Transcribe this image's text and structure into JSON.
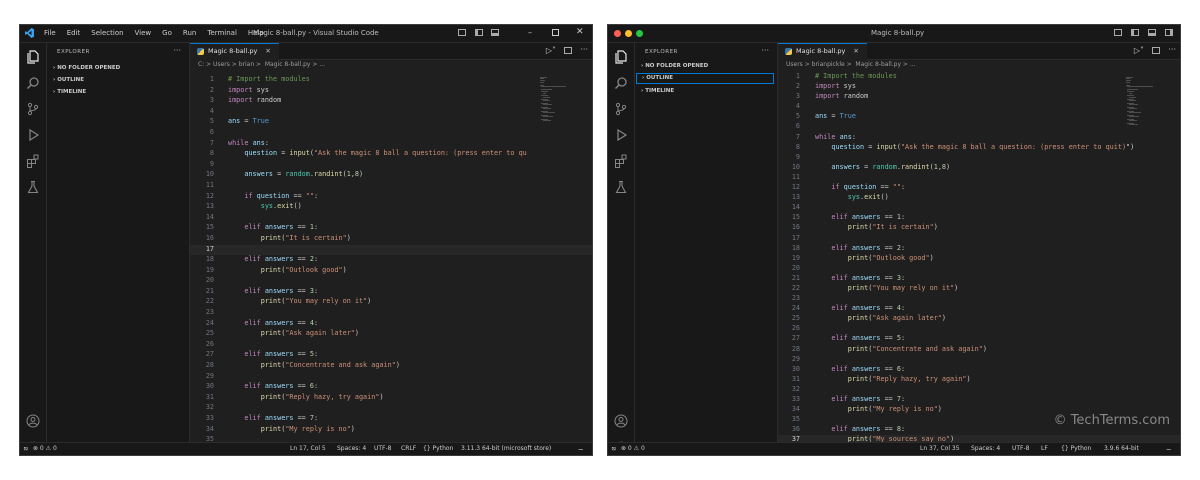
{
  "colors": {
    "accent": "#0078d4",
    "keyword": "#c586c0",
    "string": "#ce9178",
    "comment": "#6a9955"
  },
  "left_window": {
    "menu": [
      "File",
      "Edit",
      "Selection",
      "View",
      "Go",
      "Run",
      "Terminal",
      "Help"
    ],
    "title": "Magic 8-ball.py - Visual Studio Code",
    "explorer_title": "EXPLORER",
    "sections": [
      "NO FOLDER OPENED",
      "OUTLINE",
      "TIMELINE"
    ],
    "tab": "Magic 8-ball.py",
    "breadcrumb": "C: > Users > brian >  Magic 8-ball.py > ...",
    "status_left": "⊗ 0  ⚠ 0",
    "status_right": [
      "Ln 17, Col 5",
      "Spaces: 4",
      "UTF-8",
      "CRLF",
      "{} Python",
      "3.11.3 64-bit (microsoft store)"
    ],
    "current_line": 17,
    "line_numbers": [
      "1",
      "2",
      "3",
      "4",
      "5",
      "6",
      "7",
      "8",
      "9",
      "10",
      "11",
      "12",
      "13",
      "14",
      "15",
      "16",
      "17",
      "18",
      "19",
      "20",
      "21",
      "22",
      "23",
      "24",
      "25",
      "26",
      "27",
      "28",
      "29",
      "30",
      "31",
      "32",
      "33",
      "34",
      "35"
    ]
  },
  "right_window": {
    "title": "Magic 8-ball.py",
    "explorer_title": "EXPLORER",
    "sections": [
      "NO FOLDER OPENED",
      "OUTLINE",
      "TIMELINE"
    ],
    "tab": "Magic 8-ball.py",
    "breadcrumb": "Users > brianpickle >  Magic 8-ball.py > ...",
    "status_left": "⊗ 0  ⚠ 0",
    "status_right": [
      "Ln 37, Col 35",
      "Spaces: 4",
      "UTF-8",
      "LF",
      "{} Python",
      "3.9.6 64-bit"
    ],
    "current_line": 37,
    "line_numbers": [
      "1",
      "2",
      "3",
      "4",
      "5",
      "6",
      "7",
      "8",
      "9",
      "10",
      "11",
      "12",
      "13",
      "14",
      "15",
      "16",
      "17",
      "18",
      "19",
      "20",
      "21",
      "22",
      "23",
      "24",
      "25",
      "26",
      "27",
      "28",
      "29",
      "30",
      "31",
      "32",
      "33",
      "34",
      "35",
      "36",
      "37"
    ]
  },
  "code_left": [
    [
      [
        "c",
        "# Import the modules"
      ]
    ],
    [
      [
        "k",
        "import"
      ],
      [
        "p",
        " sys"
      ]
    ],
    [
      [
        "k",
        "import"
      ],
      [
        "p",
        " random"
      ]
    ],
    [],
    [
      [
        "v",
        "ans"
      ],
      [
        "p",
        " = "
      ],
      [
        "b",
        "True"
      ]
    ],
    [],
    [
      [
        "k",
        "while"
      ],
      [
        "p",
        " "
      ],
      [
        "v",
        "ans"
      ],
      [
        "p",
        ":"
      ]
    ],
    [
      [
        "p",
        "    "
      ],
      [
        "v",
        "question"
      ],
      [
        "p",
        " = "
      ],
      [
        "f",
        "input"
      ],
      [
        "p",
        "("
      ],
      [
        "s",
        "\"Ask the magic 8 ball a question: (press enter to qu"
      ]
    ],
    [],
    [
      [
        "p",
        "    "
      ],
      [
        "v",
        "answers"
      ],
      [
        "p",
        " = "
      ],
      [
        "t",
        "random"
      ],
      [
        "p",
        "."
      ],
      [
        "f",
        "randint"
      ],
      [
        "p",
        "("
      ],
      [
        "n",
        "1"
      ],
      [
        "p",
        ","
      ],
      [
        "n",
        "8"
      ],
      [
        "p",
        ")"
      ]
    ],
    [],
    [
      [
        "p",
        "    "
      ],
      [
        "k",
        "if"
      ],
      [
        "p",
        " "
      ],
      [
        "v",
        "question"
      ],
      [
        "p",
        " == "
      ],
      [
        "s",
        "\"\""
      ],
      [
        "p",
        ":"
      ]
    ],
    [
      [
        "p",
        "        "
      ],
      [
        "t",
        "sys"
      ],
      [
        "p",
        "."
      ],
      [
        "f",
        "exit"
      ],
      [
        "p",
        "()"
      ]
    ],
    [],
    [
      [
        "p",
        "    "
      ],
      [
        "k",
        "elif"
      ],
      [
        "p",
        " "
      ],
      [
        "v",
        "answers"
      ],
      [
        "p",
        " == "
      ],
      [
        "n",
        "1"
      ],
      [
        "p",
        ":"
      ]
    ],
    [
      [
        "p",
        "        "
      ],
      [
        "f",
        "print"
      ],
      [
        "p",
        "("
      ],
      [
        "s",
        "\"It is certain\""
      ],
      [
        "p",
        ")"
      ]
    ],
    [],
    [
      [
        "p",
        "    "
      ],
      [
        "k",
        "elif"
      ],
      [
        "p",
        " "
      ],
      [
        "v",
        "answers"
      ],
      [
        "p",
        " == "
      ],
      [
        "n",
        "2"
      ],
      [
        "p",
        ":"
      ]
    ],
    [
      [
        "p",
        "        "
      ],
      [
        "f",
        "print"
      ],
      [
        "p",
        "("
      ],
      [
        "s",
        "\"Outlook good\""
      ],
      [
        "p",
        ")"
      ]
    ],
    [],
    [
      [
        "p",
        "    "
      ],
      [
        "k",
        "elif"
      ],
      [
        "p",
        " "
      ],
      [
        "v",
        "answers"
      ],
      [
        "p",
        " == "
      ],
      [
        "n",
        "3"
      ],
      [
        "p",
        ":"
      ]
    ],
    [
      [
        "p",
        "        "
      ],
      [
        "f",
        "print"
      ],
      [
        "p",
        "("
      ],
      [
        "s",
        "\"You may rely on it\""
      ],
      [
        "p",
        ")"
      ]
    ],
    [],
    [
      [
        "p",
        "    "
      ],
      [
        "k",
        "elif"
      ],
      [
        "p",
        " "
      ],
      [
        "v",
        "answers"
      ],
      [
        "p",
        " == "
      ],
      [
        "n",
        "4"
      ],
      [
        "p",
        ":"
      ]
    ],
    [
      [
        "p",
        "        "
      ],
      [
        "f",
        "print"
      ],
      [
        "p",
        "("
      ],
      [
        "s",
        "\"Ask again later\""
      ],
      [
        "p",
        ")"
      ]
    ],
    [],
    [
      [
        "p",
        "    "
      ],
      [
        "k",
        "elif"
      ],
      [
        "p",
        " "
      ],
      [
        "v",
        "answers"
      ],
      [
        "p",
        " == "
      ],
      [
        "n",
        "5"
      ],
      [
        "p",
        ":"
      ]
    ],
    [
      [
        "p",
        "        "
      ],
      [
        "f",
        "print"
      ],
      [
        "p",
        "("
      ],
      [
        "s",
        "\"Concentrate and ask again\""
      ],
      [
        "p",
        ")"
      ]
    ],
    [],
    [
      [
        "p",
        "    "
      ],
      [
        "k",
        "elif"
      ],
      [
        "p",
        " "
      ],
      [
        "v",
        "answers"
      ],
      [
        "p",
        " == "
      ],
      [
        "n",
        "6"
      ],
      [
        "p",
        ":"
      ]
    ],
    [
      [
        "p",
        "        "
      ],
      [
        "f",
        "print"
      ],
      [
        "p",
        "("
      ],
      [
        "s",
        "\"Reply hazy, try again\""
      ],
      [
        "p",
        ")"
      ]
    ],
    [],
    [
      [
        "p",
        "    "
      ],
      [
        "k",
        "elif"
      ],
      [
        "p",
        " "
      ],
      [
        "v",
        "answers"
      ],
      [
        "p",
        " == "
      ],
      [
        "n",
        "7"
      ],
      [
        "p",
        ":"
      ]
    ],
    [
      [
        "p",
        "        "
      ],
      [
        "f",
        "print"
      ],
      [
        "p",
        "("
      ],
      [
        "s",
        "\"My reply is no\""
      ],
      [
        "p",
        ")"
      ]
    ],
    []
  ],
  "code_right": [
    [
      [
        "c",
        "# Import the modules"
      ]
    ],
    [
      [
        "k",
        "import"
      ],
      [
        "p",
        " sys"
      ]
    ],
    [
      [
        "k",
        "import"
      ],
      [
        "p",
        " random"
      ]
    ],
    [],
    [
      [
        "v",
        "ans"
      ],
      [
        "p",
        " = "
      ],
      [
        "b",
        "True"
      ]
    ],
    [],
    [
      [
        "k",
        "while"
      ],
      [
        "p",
        " "
      ],
      [
        "v",
        "ans"
      ],
      [
        "p",
        ":"
      ]
    ],
    [
      [
        "p",
        "    "
      ],
      [
        "v",
        "question"
      ],
      [
        "p",
        " = "
      ],
      [
        "f",
        "input"
      ],
      [
        "p",
        "("
      ],
      [
        "s",
        "\"Ask the magic 8 ball a question: (press enter to quit)"
      ],
      [
        "p",
        "\")"
      ]
    ],
    [],
    [
      [
        "p",
        "    "
      ],
      [
        "v",
        "answers"
      ],
      [
        "p",
        " = "
      ],
      [
        "t",
        "random"
      ],
      [
        "p",
        "."
      ],
      [
        "f",
        "randint"
      ],
      [
        "p",
        "("
      ],
      [
        "n",
        "1"
      ],
      [
        "p",
        ","
      ],
      [
        "n",
        "8"
      ],
      [
        "p",
        ")"
      ]
    ],
    [],
    [
      [
        "p",
        "    "
      ],
      [
        "k",
        "if"
      ],
      [
        "p",
        " "
      ],
      [
        "v",
        "question"
      ],
      [
        "p",
        " == "
      ],
      [
        "s",
        "\"\""
      ],
      [
        "p",
        ":"
      ]
    ],
    [
      [
        "p",
        "        "
      ],
      [
        "t",
        "sys"
      ],
      [
        "p",
        "."
      ],
      [
        "f",
        "exit"
      ],
      [
        "p",
        "()"
      ]
    ],
    [],
    [
      [
        "p",
        "    "
      ],
      [
        "k",
        "elif"
      ],
      [
        "p",
        " "
      ],
      [
        "v",
        "answers"
      ],
      [
        "p",
        " == "
      ],
      [
        "n",
        "1"
      ],
      [
        "p",
        ":"
      ]
    ],
    [
      [
        "p",
        "        "
      ],
      [
        "f",
        "print"
      ],
      [
        "p",
        "("
      ],
      [
        "s",
        "\"It is certain\""
      ],
      [
        "p",
        ")"
      ]
    ],
    [],
    [
      [
        "p",
        "    "
      ],
      [
        "k",
        "elif"
      ],
      [
        "p",
        " "
      ],
      [
        "v",
        "answers"
      ],
      [
        "p",
        " == "
      ],
      [
        "n",
        "2"
      ],
      [
        "p",
        ":"
      ]
    ],
    [
      [
        "p",
        "        "
      ],
      [
        "f",
        "print"
      ],
      [
        "p",
        "("
      ],
      [
        "s",
        "\"Outlook good\""
      ],
      [
        "p",
        ")"
      ]
    ],
    [],
    [
      [
        "p",
        "    "
      ],
      [
        "k",
        "elif"
      ],
      [
        "p",
        " "
      ],
      [
        "v",
        "answers"
      ],
      [
        "p",
        " == "
      ],
      [
        "n",
        "3"
      ],
      [
        "p",
        ":"
      ]
    ],
    [
      [
        "p",
        "        "
      ],
      [
        "f",
        "print"
      ],
      [
        "p",
        "("
      ],
      [
        "s",
        "\"You may rely on it\""
      ],
      [
        "p",
        ")"
      ]
    ],
    [],
    [
      [
        "p",
        "    "
      ],
      [
        "k",
        "elif"
      ],
      [
        "p",
        " "
      ],
      [
        "v",
        "answers"
      ],
      [
        "p",
        " == "
      ],
      [
        "n",
        "4"
      ],
      [
        "p",
        ":"
      ]
    ],
    [
      [
        "p",
        "        "
      ],
      [
        "f",
        "print"
      ],
      [
        "p",
        "("
      ],
      [
        "s",
        "\"Ask again later\""
      ],
      [
        "p",
        ")"
      ]
    ],
    [],
    [
      [
        "p",
        "    "
      ],
      [
        "k",
        "elif"
      ],
      [
        "p",
        " "
      ],
      [
        "v",
        "answers"
      ],
      [
        "p",
        " == "
      ],
      [
        "n",
        "5"
      ],
      [
        "p",
        ":"
      ]
    ],
    [
      [
        "p",
        "        "
      ],
      [
        "f",
        "print"
      ],
      [
        "p",
        "("
      ],
      [
        "s",
        "\"Concentrate and ask again\""
      ],
      [
        "p",
        ")"
      ]
    ],
    [],
    [
      [
        "p",
        "    "
      ],
      [
        "k",
        "elif"
      ],
      [
        "p",
        " "
      ],
      [
        "v",
        "answers"
      ],
      [
        "p",
        " == "
      ],
      [
        "n",
        "6"
      ],
      [
        "p",
        ":"
      ]
    ],
    [
      [
        "p",
        "        "
      ],
      [
        "f",
        "print"
      ],
      [
        "p",
        "("
      ],
      [
        "s",
        "\"Reply hazy, try again\""
      ],
      [
        "p",
        ")"
      ]
    ],
    [],
    [
      [
        "p",
        "    "
      ],
      [
        "k",
        "elif"
      ],
      [
        "p",
        " "
      ],
      [
        "v",
        "answers"
      ],
      [
        "p",
        " == "
      ],
      [
        "n",
        "7"
      ],
      [
        "p",
        ":"
      ]
    ],
    [
      [
        "p",
        "        "
      ],
      [
        "f",
        "print"
      ],
      [
        "p",
        "("
      ],
      [
        "s",
        "\"My reply is no\""
      ],
      [
        "p",
        ")"
      ]
    ],
    [],
    [
      [
        "p",
        "    "
      ],
      [
        "k",
        "elif"
      ],
      [
        "p",
        " "
      ],
      [
        "v",
        "answers"
      ],
      [
        "p",
        " == "
      ],
      [
        "n",
        "8"
      ],
      [
        "p",
        ":"
      ]
    ],
    [
      [
        "p",
        "        "
      ],
      [
        "f",
        "print"
      ],
      [
        "p",
        "("
      ],
      [
        "s",
        "\"My sources say no\""
      ],
      [
        "p",
        ")"
      ]
    ]
  ],
  "watermark": "© TechTerms.com"
}
